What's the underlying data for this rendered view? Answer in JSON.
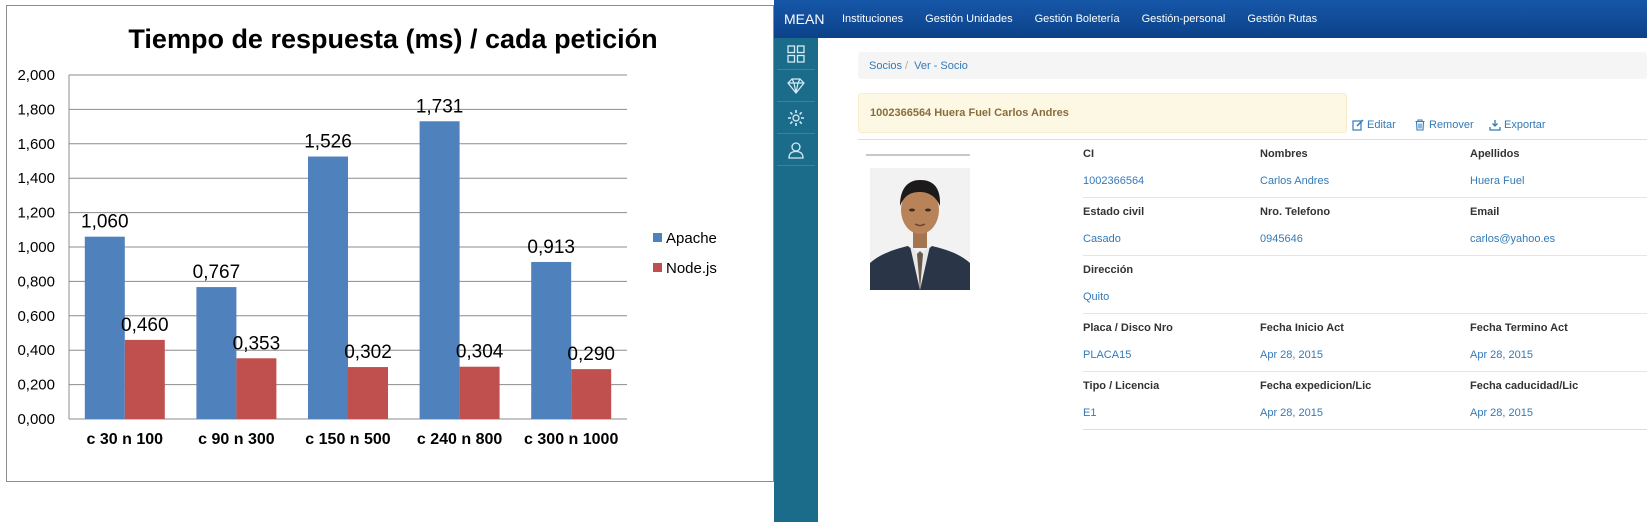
{
  "chart_data": {
    "type": "bar",
    "title": "Tiempo de respuesta  (ms) / cada petición",
    "categories": [
      "c 30  n 100",
      "c 90  n 300",
      "c 150  n 500",
      "c 240  n 800",
      "c 300  n 1000"
    ],
    "series": [
      {
        "name": "Apache",
        "values": [
          1.06,
          0.767,
          1.526,
          1.731,
          0.913
        ],
        "labels": [
          "1,060",
          "0,767",
          "1,526",
          "1,731",
          "0,913"
        ],
        "color": "#4f81bd"
      },
      {
        "name": "Node.js",
        "values": [
          0.46,
          0.353,
          0.302,
          0.304,
          0.29
        ],
        "labels": [
          "0,460",
          "0,353",
          "0,302",
          "0,304",
          "0,290"
        ],
        "color": "#c0504d"
      }
    ],
    "ylim": [
      0,
      2.0
    ],
    "yticks": [
      "0,000",
      "0,200",
      "0,400",
      "0,600",
      "0,800",
      "1,000",
      "1,200",
      "1,400",
      "1,600",
      "1,800",
      "2,000"
    ],
    "grid": true,
    "legend": "right"
  },
  "app": {
    "brand": "MEAN",
    "brand_color": "#0e4a94",
    "nav": [
      "Instituciones",
      "Gestión Unidades",
      "Gestión Boletería",
      "Gestión-personal",
      "Gestión Rutas"
    ],
    "sidebar_icons": [
      "dashboard-icon",
      "diamond-icon",
      "gear-icon",
      "user-icon"
    ],
    "breadcrumb": [
      "Socios",
      "Ver - Socio"
    ],
    "breadcrumb_sep": "/",
    "header": "1002366564 Huera Fuel Carlos Andres",
    "actions": {
      "edit": "Editar",
      "remove": "Remover",
      "export": "Exportar"
    },
    "fields": [
      [
        {
          "label": "CI",
          "value": "1002366564"
        },
        {
          "label": "Nombres",
          "value": "Carlos Andres"
        },
        {
          "label": "Apellidos",
          "value": "Huera Fuel"
        }
      ],
      [
        {
          "label": "Estado civil",
          "value": "Casado"
        },
        {
          "label": "Nro. Telefono",
          "value": "0945646"
        },
        {
          "label": "Email",
          "value": "carlos@yahoo.es"
        }
      ],
      [
        {
          "label": "Dirección",
          "value": "Quito"
        }
      ],
      [
        {
          "label": "Placa / Disco Nro",
          "value": "PLACA15"
        },
        {
          "label": "Fecha Inicio Act",
          "value": "Apr 28, 2015"
        },
        {
          "label": "Fecha Termino Act",
          "value": "Apr 28, 2015"
        }
      ],
      [
        {
          "label": "Tipo / Licencia",
          "value": "E1"
        },
        {
          "label": "Fecha expedicion/Lic",
          "value": "Apr 28, 2015"
        },
        {
          "label": "Fecha caducidad/Lic",
          "value": "Apr 28, 2015"
        }
      ]
    ]
  }
}
